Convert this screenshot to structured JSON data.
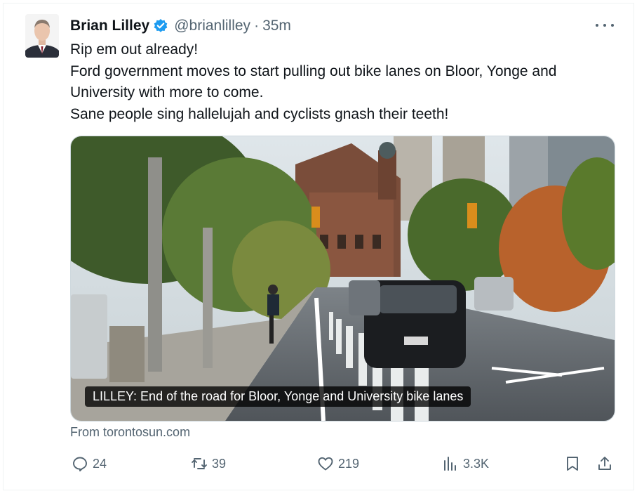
{
  "tweet": {
    "author_name": "Brian Lilley",
    "handle": "@brianlilley",
    "time_sep": "·",
    "time": "35m",
    "lines": [
      "Rip em out already!",
      "Ford government moves to start pulling out bike lanes on Bloor, Yonge and",
      "University with more to come.",
      "Sane people sing hallelujah and cyclists gnash their teeth!"
    ]
  },
  "link_card": {
    "image_icon": "street-photo",
    "caption": "LILLEY: End of the road for Bloor, Yonge and University bike lanes",
    "source": "From torontosun.com"
  },
  "actions": {
    "replies": "24",
    "reposts": "39",
    "likes": "219",
    "views": "3.3K"
  },
  "icons": [
    "verified-badge-icon",
    "more-icon",
    "reply-icon",
    "repost-icon",
    "like-icon",
    "views-icon",
    "bookmark-icon",
    "share-icon"
  ],
  "colors": {
    "verified": "#1d9bf0",
    "secondary_text": "#536471",
    "primary_text": "#0f1419"
  }
}
